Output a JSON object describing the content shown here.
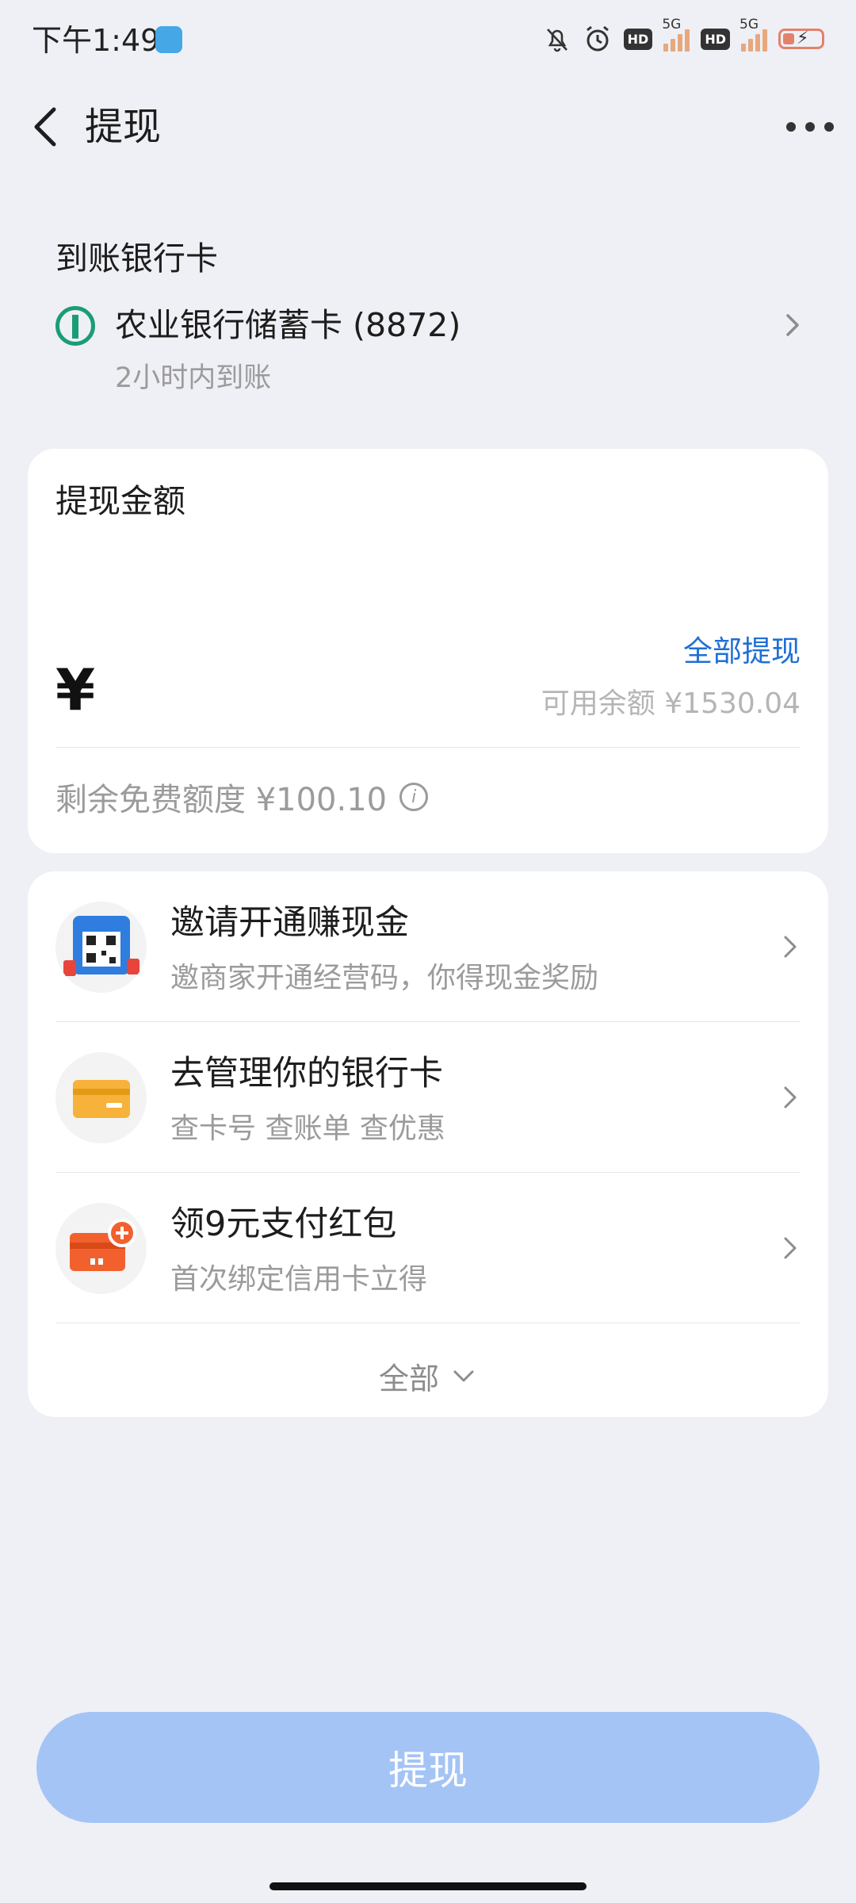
{
  "status_bar": {
    "time": "下午1:49",
    "hd1": "HD",
    "net1": "5G",
    "hd2": "HD",
    "net2": "5G"
  },
  "header": {
    "title": "提现"
  },
  "bank": {
    "section_label": "到账银行卡",
    "card_name": "农业银行储蓄卡 (8872)",
    "arrival_time": "2小时内到账"
  },
  "amount": {
    "title": "提现金额",
    "currency_symbol": "¥",
    "withdraw_all_label": "全部提现",
    "available_balance": "可用余额 ¥1530.04",
    "free_quota": "剩余免费额度 ¥100.10"
  },
  "promos": [
    {
      "title": "邀请开通赚现金",
      "subtitle": "邀商家开通经营码，你得现金奖励",
      "icon": "qr-invite-icon"
    },
    {
      "title": "去管理你的银行卡",
      "subtitle": "查卡号 查账单 查优惠",
      "icon": "bank-card-icon"
    },
    {
      "title": "领9元支付红包",
      "subtitle": "首次绑定信用卡立得",
      "icon": "credit-card-plus-icon"
    }
  ],
  "show_all_label": "全部",
  "submit_button_label": "提现",
  "colors": {
    "background": "#eff0f5",
    "link_blue": "#1f6fd6",
    "button_disabled": "#a4c4f6",
    "bank_green": "#1a9d75"
  }
}
